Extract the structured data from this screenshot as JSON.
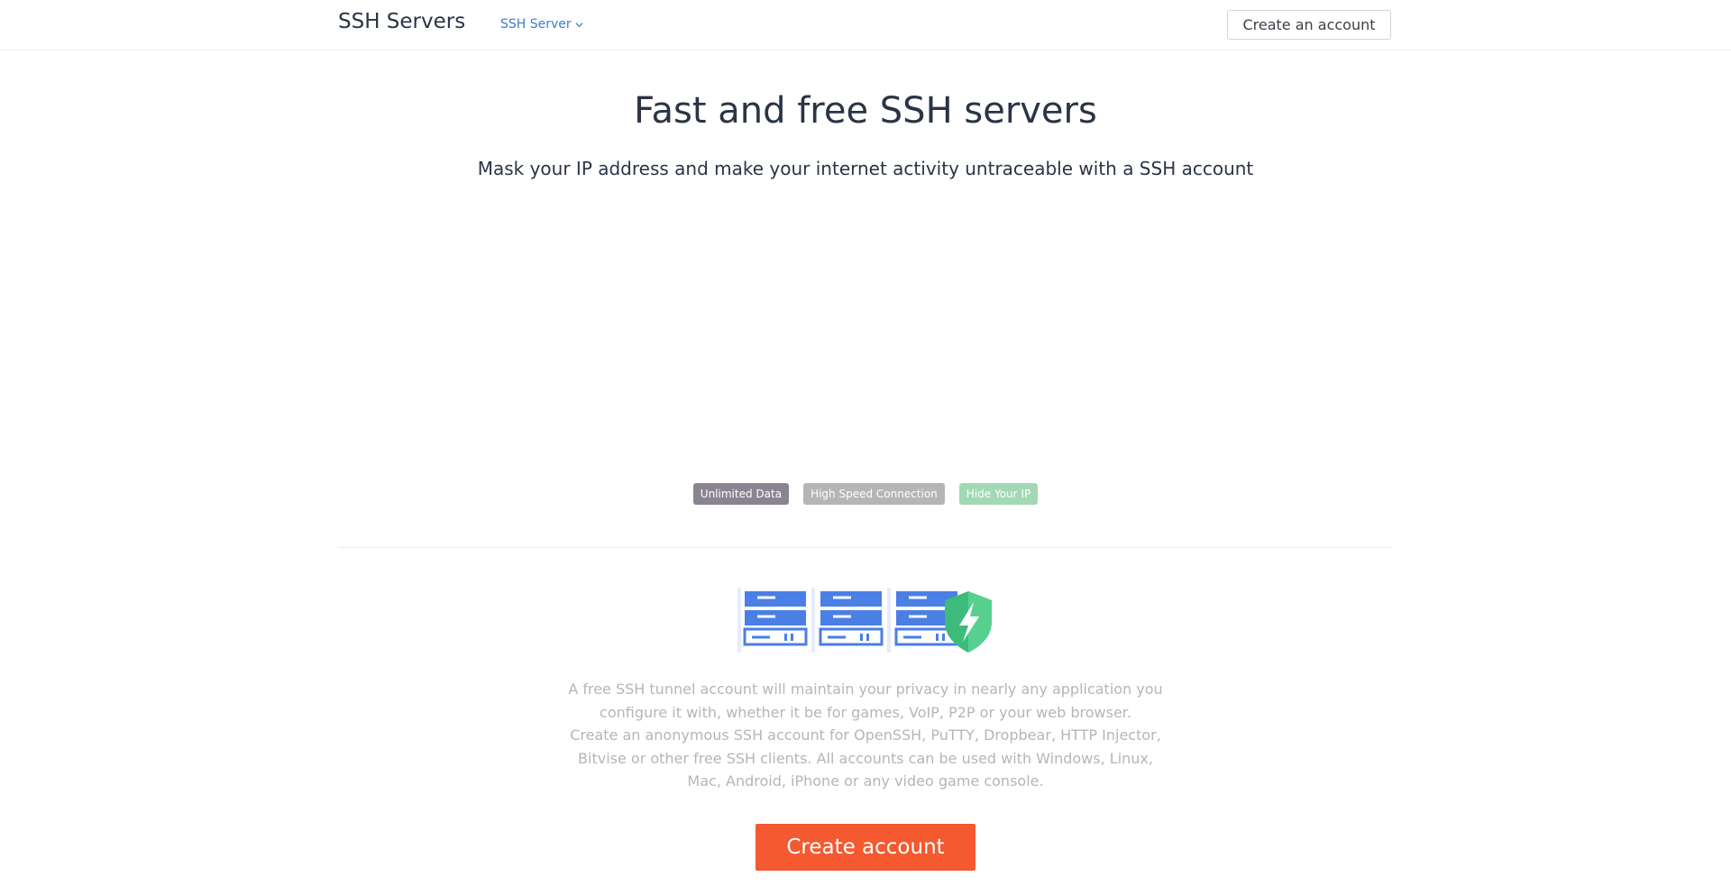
{
  "navbar": {
    "brand": "SSH Servers",
    "dropdown_label": "SSH Server",
    "dropdown_icon": "chevron-down-icon",
    "account_button": "Create an account"
  },
  "hero": {
    "title": "Fast and free SSH servers",
    "subtitle": "Mask your IP address and make your internet activity untraceable with a SSH account"
  },
  "badges": [
    {
      "label": "Unlimited Data",
      "color": "#8a8490"
    },
    {
      "label": "High Speed Connection",
      "color": "#b5b5b5"
    },
    {
      "label": "Hide Your IP",
      "color": "#a3d8b5"
    }
  ],
  "illustration": {
    "icons": [
      "server-rack-icon",
      "shield-lightning-icon"
    ],
    "server_color": "#4a7fe6",
    "shield_color": "#3dbb7b"
  },
  "description": {
    "paragraph1": "A free SSH tunnel account will maintain your privacy in nearly any application you configure it with, whether it be for games, VoIP, P2P or your web browser.",
    "paragraph2": "Create an anonymous SSH account for OpenSSH, PuTTY, Dropbear, HTTP Injector, Bitvise or other free SSH clients. All accounts can be used with Windows, Linux, Mac, Android, iPhone or any video game console."
  },
  "cta": {
    "label": "Create account",
    "color": "#f4592f"
  }
}
